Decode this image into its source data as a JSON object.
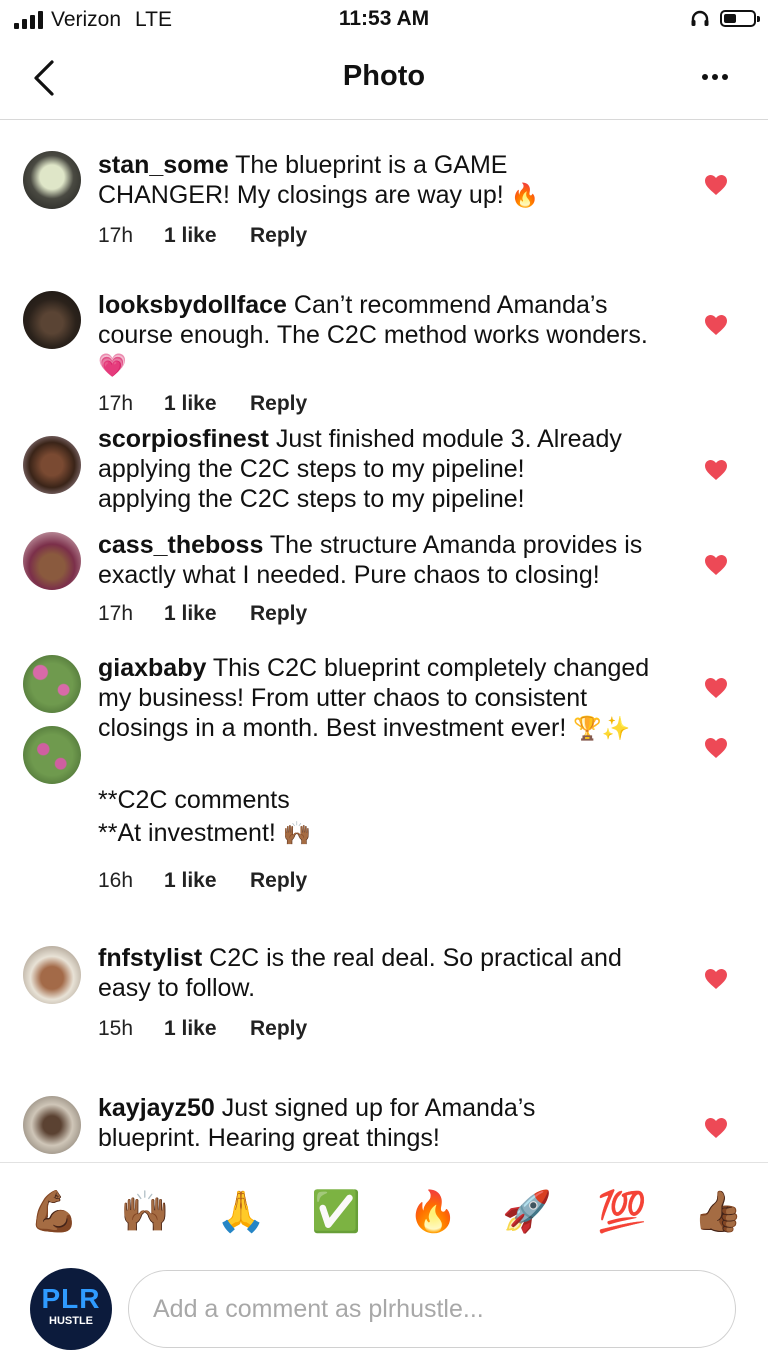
{
  "status_bar": {
    "carrier": "Verizon",
    "network": "LTE",
    "time": "11:53 AM"
  },
  "nav": {
    "title": "Photo"
  },
  "comments": [
    {
      "username": "stan_some",
      "text": "The blueprint is a GAME CHANGER! My closings are way up!",
      "emoji": "🔥",
      "time": "17h",
      "likes": "1 like",
      "reply": "Reply"
    },
    {
      "username": "looksbydollface",
      "text": "Can’t recommend Amanda’s course enough. The C2C method works wonders.",
      "emoji": "💗",
      "time": "17h",
      "likes": "1 like",
      "reply": "Reply"
    },
    {
      "username": "scorpiosfinest",
      "text": "Just finished module 3. Already applying the C2C steps to my pipeline!",
      "text_line3": "applying the C2C steps to my pipeline!"
    },
    {
      "username": "cass_theboss",
      "text": "The structure Amanda provides is exactly what I needed. Pure chaos to closing!",
      "time": "17h",
      "likes": "1 like",
      "reply": "Reply"
    },
    {
      "username": "giaxbaby",
      "text": "This C2C blueprint completely changed my business! From utter chaos to consistent closings in a month. Best investment ever!",
      "emoji": "🏆✨",
      "extra_line1": "**C2C comments",
      "extra_line2": "**At investment!",
      "extra_emoji": "🙌🏾",
      "time": "16h",
      "likes": "1 like",
      "reply": "Reply"
    },
    {
      "username": "fnfstylist",
      "text": "C2C is the real deal. So practical and easy to follow.",
      "time": "15h",
      "likes": "1 like",
      "reply": "Reply"
    },
    {
      "username": "kayjayz50",
      "text": "Just signed up for Amanda’s blueprint. Hearing great things!"
    }
  ],
  "emoji_bar": [
    "💪🏾",
    "🙌🏾",
    "🙏",
    "✅",
    "🔥",
    "🚀",
    "💯",
    "👍🏾"
  ],
  "composer": {
    "avatar_line1": "PLR",
    "avatar_line2": "HUSTLE",
    "placeholder": "Add a comment as plrhustle..."
  },
  "colors": {
    "heart": "#ed4956",
    "placeholder": "#a8a8a8",
    "divider": "#d8d8d8"
  }
}
